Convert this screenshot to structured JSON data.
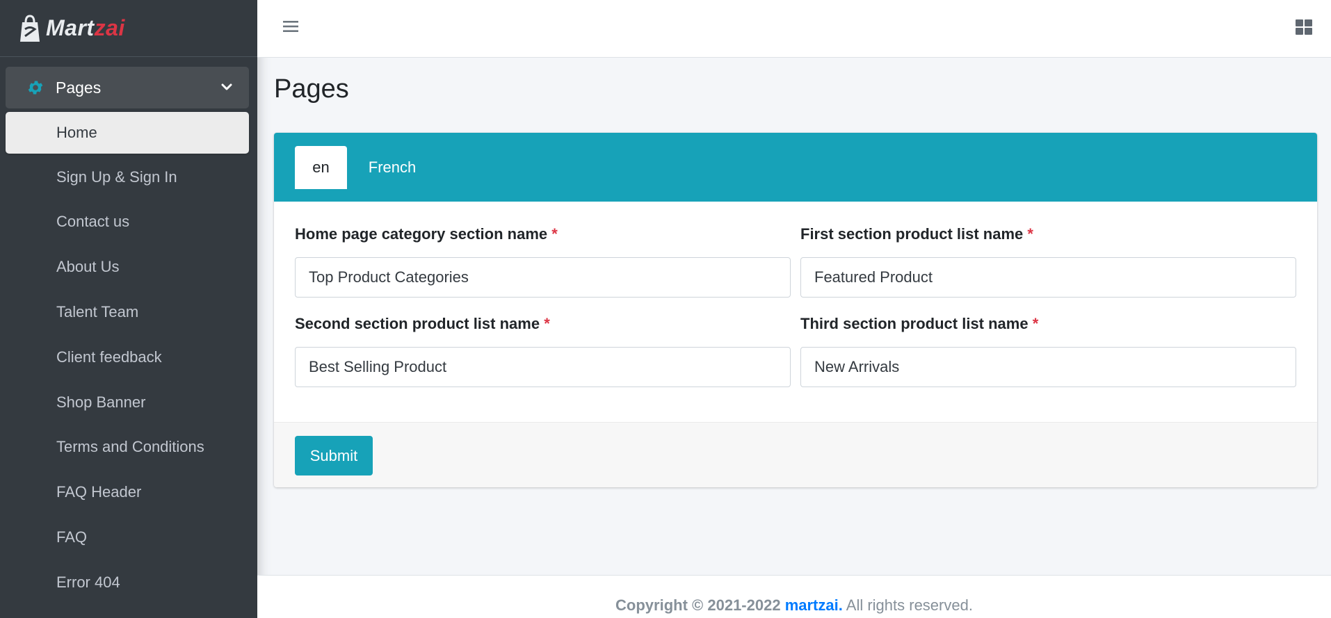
{
  "brand": {
    "part1": "Mart",
    "part2": "zai"
  },
  "sidebar": {
    "parent": {
      "label": "Pages",
      "icon": "gear-icon"
    },
    "items": [
      {
        "label": "Home",
        "active": true
      },
      {
        "label": "Sign Up & Sign In"
      },
      {
        "label": "Contact us"
      },
      {
        "label": "About Us"
      },
      {
        "label": "Talent Team"
      },
      {
        "label": "Client feedback"
      },
      {
        "label": "Shop Banner"
      },
      {
        "label": "Terms and Conditions"
      },
      {
        "label": "FAQ Header"
      },
      {
        "label": "FAQ"
      },
      {
        "label": "Error 404"
      }
    ]
  },
  "main": {
    "title": "Pages",
    "tabs": [
      {
        "label": "en",
        "active": true
      },
      {
        "label": "French"
      }
    ],
    "fields": {
      "home_category": {
        "label": "Home page category section name",
        "required": "*",
        "value": "Top Product Categories"
      },
      "first_section": {
        "label": "First section product list name",
        "required": "*",
        "value": "Featured Product"
      },
      "second_section": {
        "label": "Second section product list name",
        "required": "*",
        "value": "Best Selling Product"
      },
      "third_section": {
        "label": "Third section product list name",
        "required": "*",
        "value": "New Arrivals"
      }
    },
    "submit_label": "Submit"
  },
  "footer": {
    "copyright": "Copyright © 2021-2022",
    "brand_link": "martzai.",
    "rights": "All rights reserved."
  },
  "colors": {
    "accent": "#17a2b8",
    "sidebar_bg": "#343a40",
    "required": "#dc3545",
    "link": "#007bff"
  }
}
